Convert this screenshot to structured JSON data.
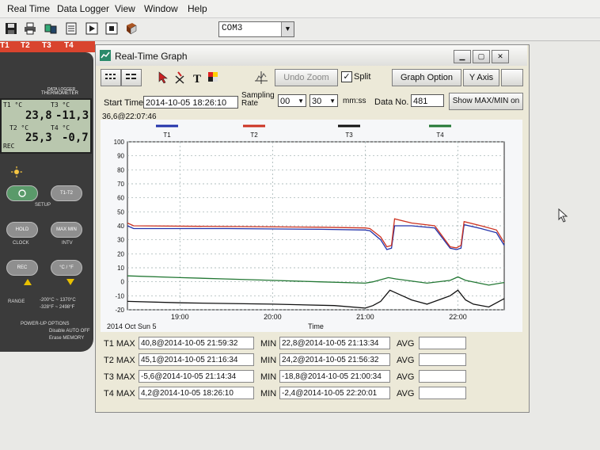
{
  "menu": [
    "Real Time",
    "Data Logger",
    "View",
    "Window",
    "Help"
  ],
  "toolbar": {
    "icons": [
      "save-icon",
      "print-icon",
      "connect-icon",
      "document-icon",
      "play-icon",
      "stop-icon",
      "book-icon"
    ],
    "port": "COM3"
  },
  "channel_tabs": [
    "T1",
    "T2",
    "T3",
    "T4"
  ],
  "meter": {
    "header_small": "DATA LOGGER",
    "header": "THERMOMETER",
    "t1_label": "T1 °C",
    "t1": "23,8",
    "t3_label": "T3 °C",
    "t3": "-11,3",
    "t2_label": "T2 °C",
    "t2": "25,3",
    "t4_label": "T4 °C",
    "t4": "-0,7",
    "rec": "REC",
    "buttons": {
      "t1t2": "T1-T2",
      "hold": "HOLD",
      "maxmin": "MAX MIN",
      "rec": "REC",
      "cf": "°C / °F"
    },
    "setup": "SETUP",
    "clock": "CLOCK",
    "intv": "INTV",
    "range_label": "RANGE",
    "range_c": "-200°C ~ 1370°C",
    "range_f": "-328°F ~ 2498°F",
    "powerup": "POWER-UP OPTIONS",
    "powerup1": "Disable AUTO OFF",
    "powerup2": "Erase MEMORY"
  },
  "window": {
    "title": "Real-Time Graph",
    "undo_zoom": "Undo Zoom",
    "split_label": "Split",
    "split_checked": true,
    "graph_option": "Graph Option",
    "y_axis": "Y Axis",
    "start_time_label": "Start Time",
    "start_time": "2014-10-05 18:26:10",
    "sampling_rate_label": "Sampling Rate",
    "rate_min": "00",
    "rate_sec": "30",
    "rate_unit": "mm:ss",
    "data_no_label": "Data No.",
    "data_no": "481",
    "show_maxmin": "Show MAX/MIN on",
    "cursor_readout": "36,6@22:07:46"
  },
  "stats": [
    {
      "max_label": "T1 MAX",
      "max": "40,8@2014-10-05 21:59:32",
      "min_label": "MIN",
      "min": "22,8@2014-10-05 21:13:34",
      "avg_label": "AVG",
      "avg": ""
    },
    {
      "max_label": "T2 MAX",
      "max": "45,1@2014-10-05 21:16:34",
      "min_label": "MIN",
      "min": "24,2@2014-10-05 21:56:32",
      "avg_label": "AVG",
      "avg": ""
    },
    {
      "max_label": "T3 MAX",
      "max": "-5,6@2014-10-05 21:14:34",
      "min_label": "MIN",
      "min": "-18,8@2014-10-05 21:00:34",
      "avg_label": "AVG",
      "avg": ""
    },
    {
      "max_label": "T4 MAX",
      "max": "4,2@2014-10-05 18:26:10",
      "min_label": "MIN",
      "min": "-2,4@2014-10-05 22:20:01",
      "avg_label": "AVG",
      "avg": ""
    }
  ],
  "chart_data": {
    "type": "line",
    "date_label": "2014 Oct Sun 5",
    "xlabel": "Time",
    "xlim": [
      "18:26",
      "22:30"
    ],
    "x_ticks": [
      "19:00",
      "20:00",
      "21:00",
      "22:00"
    ],
    "ylim": [
      -20,
      100
    ],
    "y_ticks": [
      100,
      90,
      80,
      70,
      60,
      50,
      40,
      30,
      20,
      10,
      0,
      -10,
      -20
    ],
    "grid": true,
    "legend": "top",
    "series": [
      {
        "name": "T1",
        "color": "#2233aa",
        "x": [
          "18:26",
          "18:30",
          "19:30",
          "20:30",
          "21:00",
          "21:03",
          "21:10",
          "21:14",
          "21:17",
          "21:19",
          "21:30",
          "21:45",
          "21:55",
          "21:59",
          "22:02",
          "22:04",
          "22:15",
          "22:25",
          "22:30"
        ],
        "y": [
          40,
          38,
          38,
          37.5,
          37,
          36.5,
          30,
          23,
          24,
          40,
          40,
          38.5,
          24,
          23,
          24,
          40.8,
          38,
          35,
          26
        ]
      },
      {
        "name": "T2",
        "color": "#cc3322",
        "x": [
          "18:26",
          "18:30",
          "19:30",
          "20:30",
          "21:00",
          "21:03",
          "21:10",
          "21:14",
          "21:17",
          "21:19",
          "21:30",
          "21:45",
          "21:55",
          "21:59",
          "22:02",
          "22:04",
          "22:15",
          "22:25",
          "22:30"
        ],
        "y": [
          42,
          40,
          39.5,
          39,
          38.5,
          38,
          32,
          25,
          26,
          45,
          42,
          40,
          25,
          24.2,
          26,
          43,
          40,
          37,
          28
        ]
      },
      {
        "name": "T3",
        "color": "#111111",
        "x": [
          "18:26",
          "19:00",
          "20:00",
          "20:40",
          "21:00",
          "21:05",
          "21:10",
          "21:16",
          "21:20",
          "21:30",
          "21:40",
          "21:50",
          "21:55",
          "22:00",
          "22:05",
          "22:10",
          "22:20",
          "22:30"
        ],
        "y": [
          -14,
          -15,
          -16,
          -17,
          -18.8,
          -17,
          -14,
          -6,
          -8,
          -13,
          -16,
          -12,
          -10,
          -6,
          -13,
          -16,
          -18,
          -12
        ]
      },
      {
        "name": "T4",
        "color": "#227733",
        "x": [
          "18:26",
          "19:00",
          "19:30",
          "20:00",
          "20:30",
          "21:00",
          "21:05",
          "21:15",
          "21:20",
          "21:40",
          "21:55",
          "22:00",
          "22:05",
          "22:20",
          "22:30"
        ],
        "y": [
          4.2,
          3,
          2,
          1,
          0,
          -1,
          0,
          3,
          2,
          -1,
          1,
          3.5,
          1,
          -2.4,
          -0.5
        ]
      }
    ]
  }
}
